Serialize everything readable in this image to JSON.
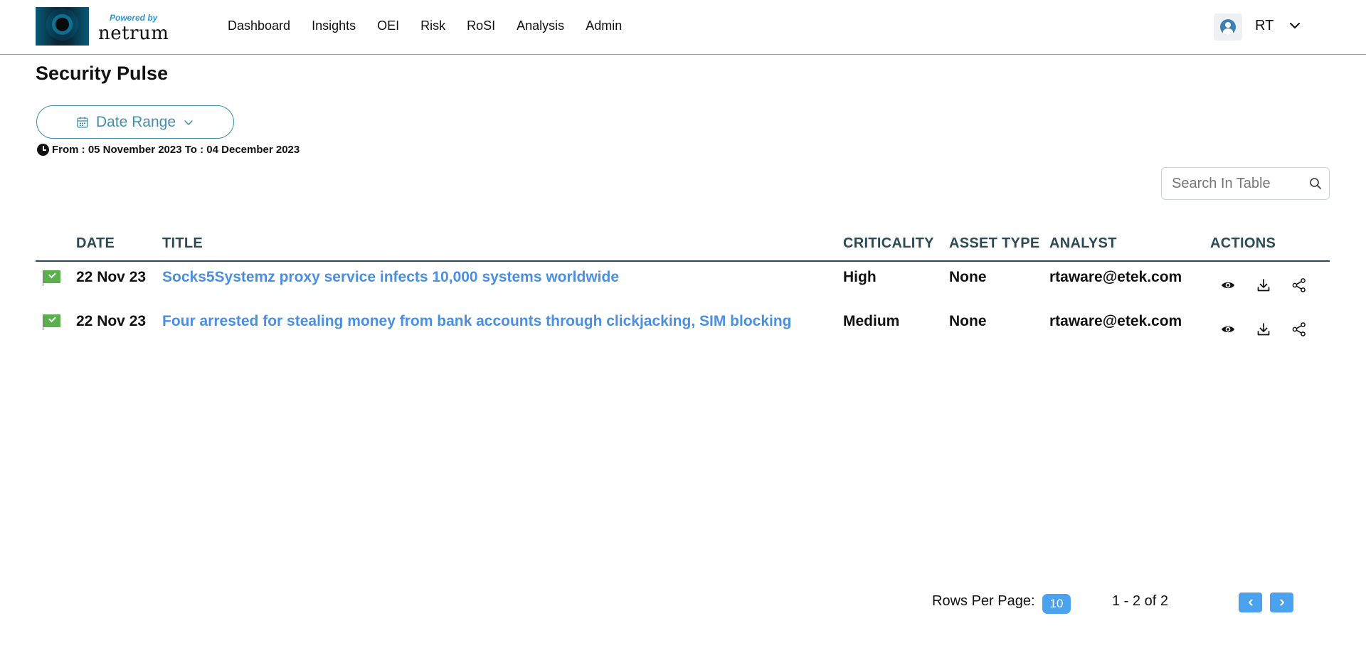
{
  "header": {
    "powered_by": "Powered by",
    "brand": "netrum",
    "nav": [
      "Dashboard",
      "Insights",
      "OEI",
      "Risk",
      "RoSI",
      "Analysis",
      "Admin"
    ],
    "user_initials": "RT"
  },
  "page": {
    "title": "Security Pulse",
    "date_range_label": "Date Range",
    "range_text": "From : 05 November 2023 To : 04 December 2023"
  },
  "search": {
    "placeholder": "Search In Table"
  },
  "table": {
    "columns": [
      "DATE",
      "TITLE",
      "CRITICALITY",
      "ASSET TYPE",
      "ANALYST",
      "ACTIONS"
    ],
    "rows": [
      {
        "date": "22 Nov 23",
        "title": "Socks5Systemz proxy service infects 10,000 systems worldwide",
        "criticality": "High",
        "asset_type": "None",
        "analyst": "rtaware@etek.com"
      },
      {
        "date": "22 Nov 23",
        "title": "Four arrested for stealing money from bank accounts through clickjacking, SIM blocking",
        "criticality": "Medium",
        "asset_type": "None",
        "analyst": "rtaware@etek.com"
      }
    ]
  },
  "pagination": {
    "rows_per_page_label": "Rows Per Page:",
    "rows_per_page": "10",
    "range": "1 - 2 of 2"
  },
  "colors": {
    "accent": "#4ba3ef",
    "link": "#4a8fe0",
    "header_text": "#2c4a55",
    "flag": "#5ab04b"
  }
}
